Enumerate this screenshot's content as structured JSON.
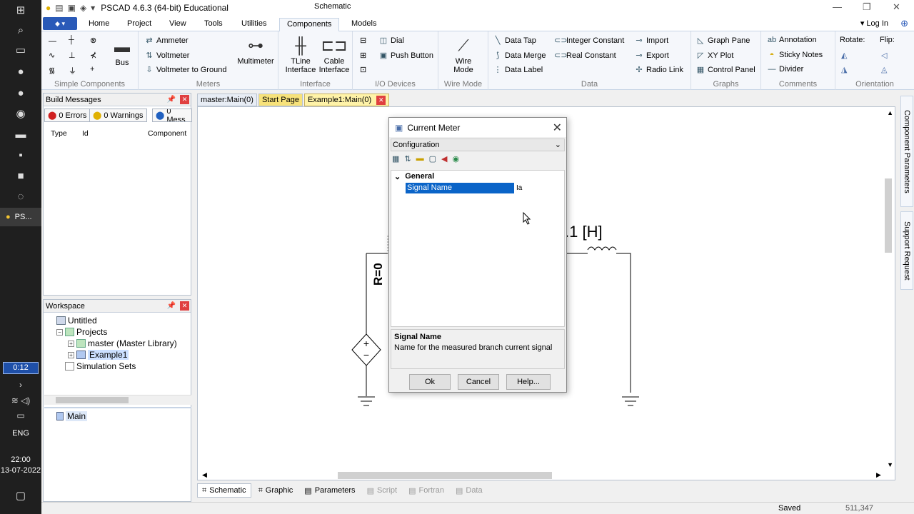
{
  "taskbar": {
    "active_app": "PS...",
    "timer": "0:12",
    "lang": "ENG",
    "time": "22:00",
    "date": "13-07-2022"
  },
  "window": {
    "app_title": "PSCAD 4.6.3 (64-bit) Educational",
    "center_title": "Schematic"
  },
  "ribbon_tabs": [
    "Home",
    "Project",
    "View",
    "Tools",
    "Utilities",
    "Components",
    "Models"
  ],
  "login": "Log In",
  "ribbon": {
    "simple": {
      "label": "Simple Components",
      "bus": "Bus"
    },
    "meters": {
      "label": "Meters",
      "ammeter": "Ammeter",
      "voltmeter": "Voltmeter",
      "voltmeter_ground": "Voltmeter to Ground",
      "multimeter": "Multimeter"
    },
    "interface": {
      "label": "Interface",
      "tline": "TLine\nInterface",
      "cable": "Cable\nInterface"
    },
    "io": {
      "label": "I/O Devices",
      "dial": "Dial",
      "push": "Push Button"
    },
    "wire": {
      "label": "Wire Mode",
      "wire": "Wire\nMode"
    },
    "data": {
      "label": "Data",
      "tap": "Data Tap",
      "merge": "Data Merge",
      "dlabel": "Data Label",
      "int": "Integer Constant",
      "real": "Real Constant",
      "import": "Import",
      "export": "Export",
      "radio": "Radio Link"
    },
    "graphs": {
      "label": "Graphs",
      "pane": "Graph Pane",
      "xy": "XY Plot",
      "control": "Control Panel"
    },
    "comments": {
      "label": "Comments",
      "annotation": "Annotation",
      "sticky": "Sticky Notes",
      "divider": "Divider"
    },
    "orientation": {
      "label": "Orientation",
      "rotate": "Rotate:",
      "flip": "Flip:"
    }
  },
  "build": {
    "title": "Build Messages",
    "errors": "0 Errors",
    "warnings": "0 Warnings",
    "messages": "0 Mess",
    "cols": [
      "Type",
      "Id",
      "Component"
    ]
  },
  "workspace": {
    "title": "Workspace",
    "untitled": "Untitled",
    "projects": "Projects",
    "master": "master (Master Library)",
    "example": "Example1",
    "sim": "Simulation Sets",
    "main": "Main"
  },
  "doc_tabs": [
    "master:Main(0)",
    "Start Page",
    "Example1:Main(0)"
  ],
  "canvas": {
    "inductor_label": ".1 [H]",
    "resistor_label": "R=0"
  },
  "bottom_tabs": [
    "Schematic",
    "Graphic",
    "Parameters",
    "Script",
    "Fortran",
    "Data"
  ],
  "side_tabs": [
    "Component Parameters",
    "Support Request"
  ],
  "status": {
    "saved": "Saved",
    "coords": "511,347"
  },
  "dialog": {
    "title": "Current Meter",
    "combo": "Configuration",
    "category": "General",
    "prop_name": "Signal Name",
    "prop_value": "Ia",
    "desc_title": "Signal Name",
    "desc_text": "Name for the measured branch current signal",
    "ok": "Ok",
    "cancel": "Cancel",
    "help": "Help..."
  }
}
